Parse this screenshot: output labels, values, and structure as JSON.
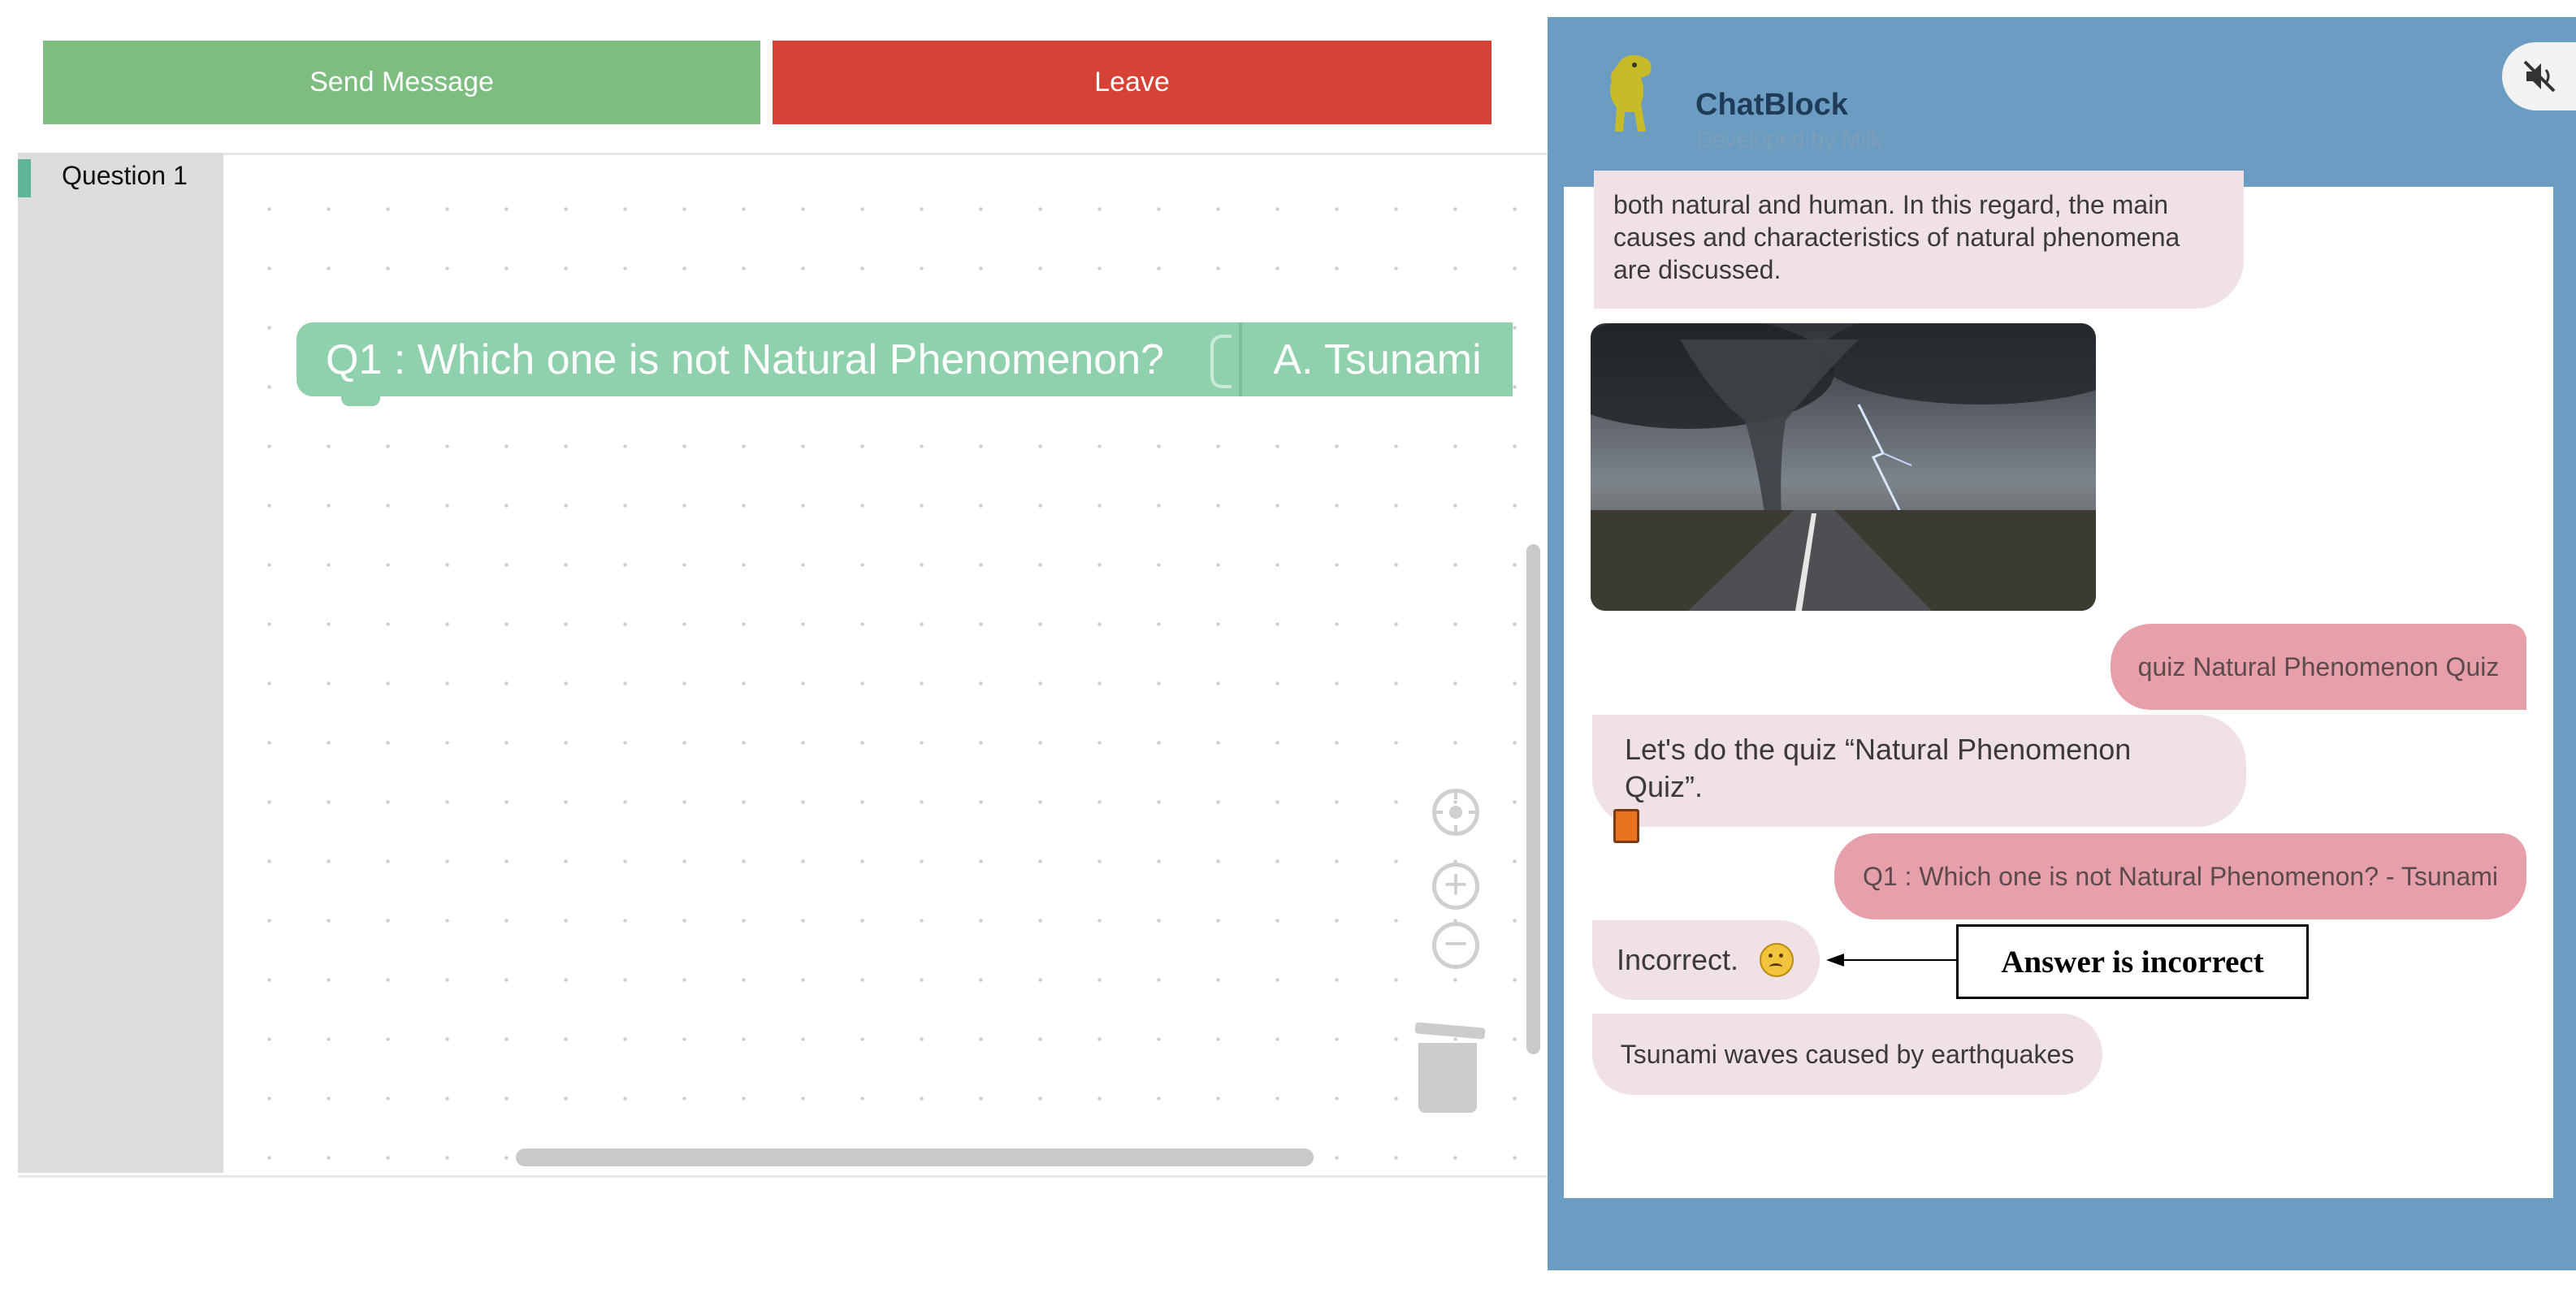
{
  "toolbar": {
    "send_label": "Send Message",
    "leave_label": "Leave"
  },
  "toolbox": {
    "category_label": "Question 1"
  },
  "workspace": {
    "question_block": "Q1 : Which one is not Natural Phenomenon?",
    "answer_block": "A. Tsunami"
  },
  "chat": {
    "title": "ChatBlock",
    "subtitle": "Developed by Milk",
    "messages": [
      {
        "sender": "bot",
        "text": "both natural and human. In this regard, the main causes and characteristics of natural phenomena are discussed."
      },
      {
        "sender": "bot",
        "image": "tornado-storm-road"
      },
      {
        "sender": "user",
        "text": "quiz Natural Phenomenon Quiz"
      },
      {
        "sender": "bot",
        "text": "Let's do the quiz “Natural Phenomenon Quiz”."
      },
      {
        "sender": "user",
        "text": "Q1 : Which one is not Natural Phenomenon? - Tsunami"
      },
      {
        "sender": "bot",
        "text": "Incorrect."
      },
      {
        "sender": "bot",
        "text": "Tsunami waves caused by earthquakes"
      }
    ]
  },
  "annotation": {
    "label": "Answer is incorrect"
  },
  "colors": {
    "send": "#7dbd80",
    "leave": "#d64236",
    "block": "#8fd0ad",
    "chat_frame": "#6b9dc3",
    "bot_bubble": "#f0e1e6",
    "user_bubble": "#e7a0aa"
  }
}
